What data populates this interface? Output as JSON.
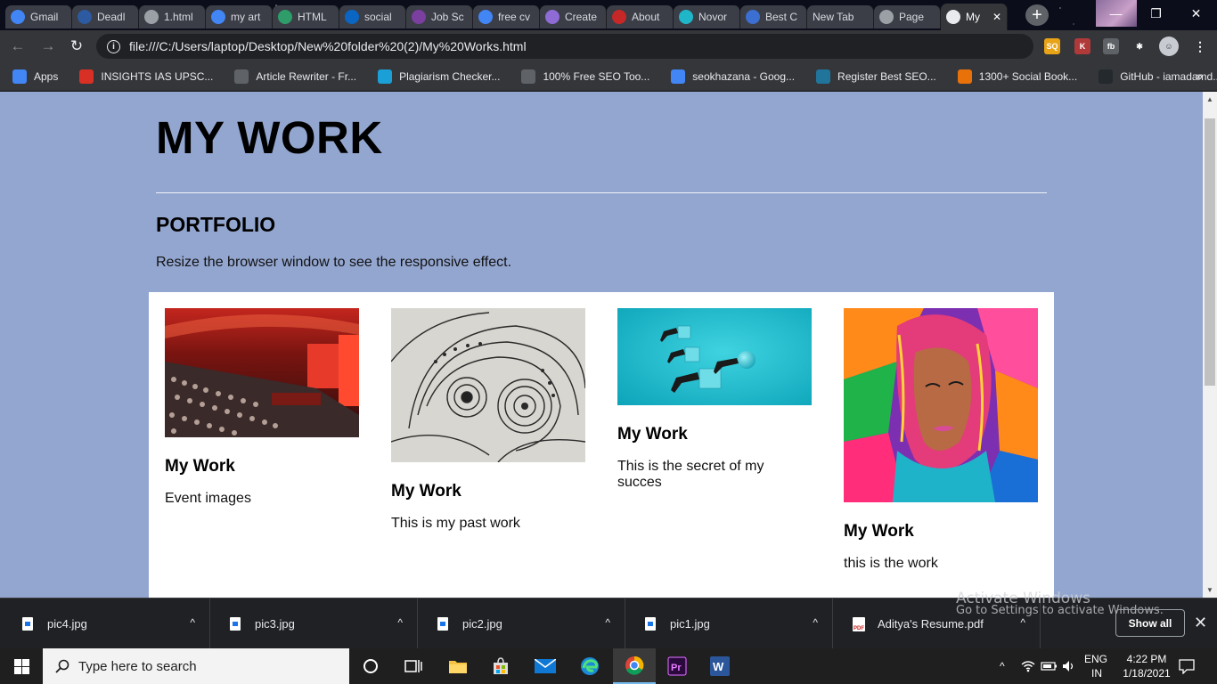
{
  "browser": {
    "tabs": [
      {
        "title": "Gmail",
        "icon": "google-icon",
        "color": "#4285f4"
      },
      {
        "title": "Deadl",
        "icon": "d-icon",
        "color": "#2d5aa0"
      },
      {
        "title": "1.html",
        "icon": "globe-icon",
        "color": "#9aa0a6"
      },
      {
        "title": "my art",
        "icon": "google-icon",
        "color": "#4285f4"
      },
      {
        "title": "HTML",
        "icon": "w-icon",
        "color": "#2e9d6a"
      },
      {
        "title": "social",
        "icon": "linkedin-icon",
        "color": "#0a66c2"
      },
      {
        "title": "Job Sc",
        "icon": "t-icon",
        "color": "#7b3fa0"
      },
      {
        "title": "free cv",
        "icon": "google-icon",
        "color": "#4285f4"
      },
      {
        "title": "Create",
        "icon": "create-icon",
        "color": "#8f6bd6"
      },
      {
        "title": "About",
        "icon": "about-icon",
        "color": "#c62828"
      },
      {
        "title": "Novor",
        "icon": "n-icon",
        "color": "#1fb6c9"
      },
      {
        "title": "Best C",
        "icon": "cv-icon",
        "color": "#3b6fd1"
      },
      {
        "title": "New Tab",
        "icon": "",
        "color": ""
      },
      {
        "title": "Page",
        "icon": "chrome-icon",
        "color": "#9aa0a6"
      },
      {
        "title": "My",
        "icon": "globe-icon",
        "color": "#e8eaed",
        "active": true
      }
    ],
    "window_controls": {
      "minimize": "—",
      "maximize": "❐",
      "close": "✕"
    },
    "nav": {
      "back": "←",
      "forward": "→",
      "reload": "↻"
    },
    "url": "file:///C:/Users/laptop/Desktop/New%20folder%20(2)/My%20Works.html",
    "extensions": [
      {
        "label": "SQ",
        "color": "#e8a317"
      },
      {
        "label": "K",
        "color": "#b03a3a"
      },
      {
        "label": "fb",
        "color": "#5f6368"
      },
      {
        "label": "✱",
        "color": "#35363a"
      }
    ],
    "bookmarks": [
      {
        "label": "Apps",
        "icon": "apps-grid-icon",
        "color": "#4285f4"
      },
      {
        "label": "INSIGHTS IAS UPSC...",
        "icon": "insights-icon",
        "color": "#d93025"
      },
      {
        "label": "Article Rewriter - Fr...",
        "icon": "sst-icon",
        "color": "#5f6368"
      },
      {
        "label": "Plagiarism Checker...",
        "icon": "plagiarism-icon",
        "color": "#1a9fd6"
      },
      {
        "label": "100% Free SEO Too...",
        "icon": "sst-icon",
        "color": "#5f6368"
      },
      {
        "label": "seokhazana - Goog...",
        "icon": "google-icon",
        "color": "#4285f4"
      },
      {
        "label": "Register Best SEO...",
        "icon": "wordpress-icon",
        "color": "#21759b"
      },
      {
        "label": "1300+ Social Book...",
        "icon": "social-icon",
        "color": "#e8710a"
      },
      {
        "label": "GitHub - iamadamd...",
        "icon": "github-icon",
        "color": "#24292e"
      }
    ],
    "bookmarks_more": "»"
  },
  "page": {
    "title": "MY WORK",
    "section_title": "PORTFOLIO",
    "section_desc": "Resize the browser window to see the responsive effect.",
    "cards": [
      {
        "image": "event-crowd-photo",
        "title": "My Work",
        "desc": "Event images",
        "aspect": 0.665
      },
      {
        "image": "paisley-art-photo",
        "title": "My Work",
        "desc": "This is my past work",
        "aspect": 0.794
      },
      {
        "image": "pushing-blocks-illustration",
        "title": "My Work",
        "desc": "This is the secret of my succes",
        "aspect": 0.5
      },
      {
        "image": "colorful-portrait-art",
        "title": "My Work",
        "desc": "this is the work",
        "aspect": 1.0
      }
    ],
    "background_color": "#93a6d0"
  },
  "downloads": {
    "items": [
      {
        "name": "pic4.jpg",
        "type": "image"
      },
      {
        "name": "pic3.jpg",
        "type": "image"
      },
      {
        "name": "pic2.jpg",
        "type": "image"
      },
      {
        "name": "pic1.jpg",
        "type": "image"
      },
      {
        "name": "Aditya's Resume.pdf",
        "type": "pdf",
        "icon_label": "PDF"
      }
    ],
    "show_all": "Show all",
    "close": "✕",
    "expand": "^"
  },
  "watermark": {
    "line1": "Activate Windows",
    "line2": "Go to Settings to activate Windows."
  },
  "taskbar": {
    "search_placeholder": "Type here to search",
    "apps": [
      "cortana-icon",
      "task-view-icon",
      "file-explorer-icon",
      "store-icon",
      "mail-icon",
      "edge-icon",
      "chrome-icon",
      "premiere-icon",
      "word-icon"
    ],
    "language": "ENG",
    "region": "IN",
    "time": "4:22 PM",
    "date": "1/18/2021",
    "tray_chevron": "^"
  }
}
